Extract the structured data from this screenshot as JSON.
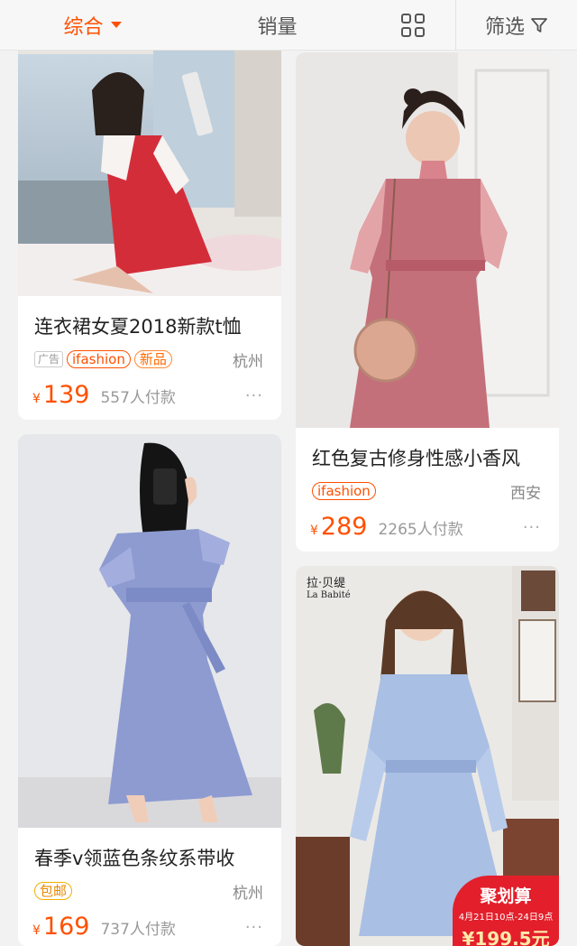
{
  "sortbar": {
    "tabs": [
      {
        "label": "综合",
        "active": true
      },
      {
        "label": "销量",
        "active": false
      }
    ],
    "view_icon": "grid-view-icon",
    "filter_label": "筛选",
    "filter_icon": "funnel-icon"
  },
  "products": [
    {
      "title": "连衣裙女夏2018新款t恤",
      "ad_label": "广告",
      "tags": [
        "ifashion",
        "新品"
      ],
      "location": "杭州",
      "currency": "¥",
      "price": "139",
      "sales": "557人付款",
      "more": "···"
    },
    {
      "title": "红色复古修身性感小香风",
      "tags": [
        "ifashion"
      ],
      "location": "西安",
      "currency": "¥",
      "price": "289",
      "sales": "2265人付款",
      "more": "···"
    },
    {
      "title": "春季v领蓝色条纹系带收",
      "tags": [
        "包邮"
      ],
      "location": "杭州",
      "currency": "¥",
      "price": "169",
      "sales": "737人付款",
      "more": "···"
    },
    {
      "brand_cn": "拉·贝缇",
      "brand_en": "La Babité",
      "promo_title": "聚划算",
      "promo_time": "4月21日10点-24日9点",
      "promo_price": "¥199.5元"
    }
  ],
  "colors": {
    "accent": "#ff5000",
    "promo_red": "#e31f2b"
  }
}
